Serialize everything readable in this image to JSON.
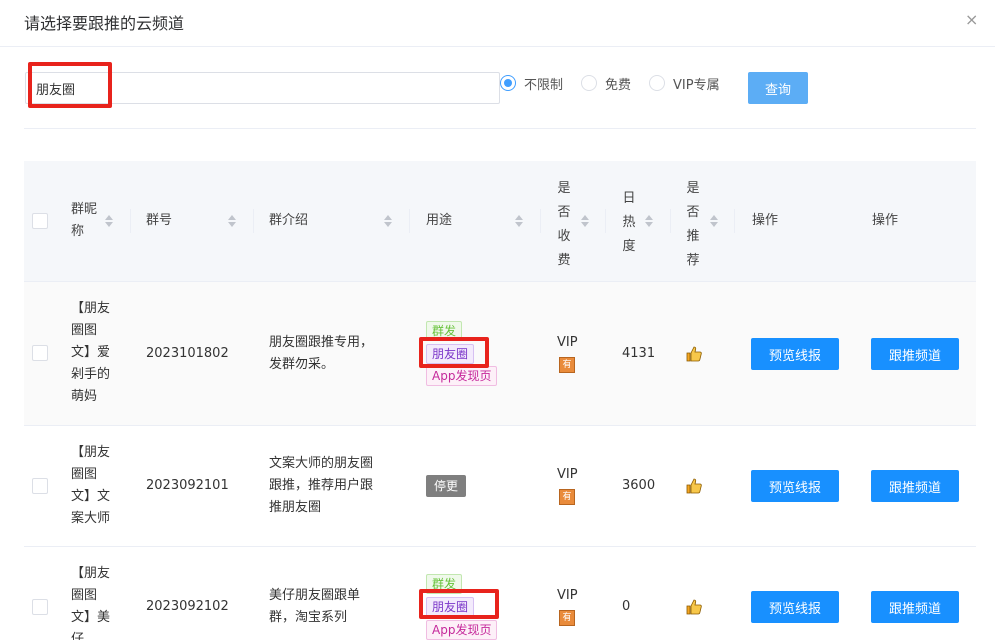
{
  "dialog": {
    "title": "请选择要跟推的云频道",
    "close_glyph": "×"
  },
  "search": {
    "value": "朋友圈",
    "placeholder": ""
  },
  "filters": {
    "options": [
      "不限制",
      "免费",
      "VIP专属"
    ],
    "selected": "不限制"
  },
  "query_label": "查询",
  "table": {
    "headers": {
      "nickname": "群昵称",
      "group_no": "群号",
      "intro": "群介绍",
      "usage": "用途",
      "paid": "是否收费",
      "heat": "日热度",
      "recommend": "是否推荐",
      "action1": "操作",
      "action2": "操作"
    },
    "rows": [
      {
        "nickname_lines": [
          "【朋友",
          "圈图",
          "文】爱",
          "剁手的",
          "萌妈"
        ],
        "group_no": "2023101802",
        "intro_lines": [
          "朋友圈跟推专用，",
          "发群勿采。"
        ],
        "tags": [
          "群发",
          "朋友圈",
          "App发现页"
        ],
        "paid": "VIP",
        "paid_badge": "有",
        "heat": "4131",
        "preview_label": "预览线报",
        "follow_label": "跟推频道"
      },
      {
        "nickname_lines": [
          "【朋友",
          "圈图",
          "文】文",
          "案大师"
        ],
        "group_no": "2023092101",
        "intro_lines": [
          "文案大师的朋友圈",
          "跟推，推荐用户跟",
          "推朋友圈"
        ],
        "tags": [
          "停更"
        ],
        "paid": "VIP",
        "paid_badge": "有",
        "heat": "3600",
        "preview_label": "预览线报",
        "follow_label": "跟推频道"
      },
      {
        "nickname_lines": [
          "【朋友",
          "圈图",
          "文】美",
          "仔"
        ],
        "group_no": "2023092102",
        "intro_lines": [
          "美仔朋友圈跟单",
          "群，淘宝系列"
        ],
        "tags": [
          "群发",
          "朋友圈",
          "App发现页"
        ],
        "paid": "VIP",
        "paid_badge": "有",
        "heat": "0",
        "preview_label": "预览线报",
        "follow_label": "跟推频道"
      }
    ]
  },
  "colors": {
    "primary": "#1890ff",
    "highlight_box": "#e8231c",
    "badge": "#e98b3b"
  }
}
